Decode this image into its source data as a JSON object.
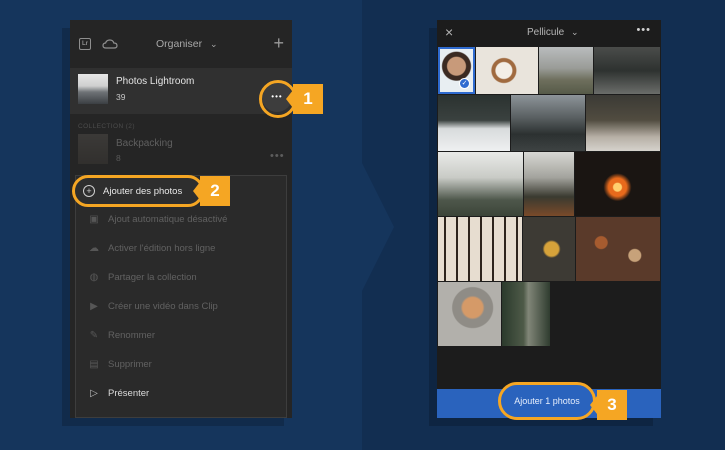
{
  "left_screen": {
    "topbar": {
      "lr_icon_text": "Lr",
      "title": "Organiser",
      "chevron": "⌄",
      "plus": "+"
    },
    "album": {
      "name": "Photos Lightroom",
      "count": "39",
      "more_glyph": "•••"
    },
    "collections": {
      "header": "COLLECTION (2)",
      "items": [
        {
          "name": "Backpacking",
          "count": "8",
          "more_glyph": "•••"
        }
      ]
    },
    "menu": {
      "add_photos": "Ajouter des photos",
      "items": [
        {
          "label": "Ajout automatique désactivé",
          "icon": "auto-add-icon"
        },
        {
          "label": "Activer l'édition hors ligne",
          "icon": "cloud-offline-icon"
        },
        {
          "label": "Partager la collection",
          "icon": "globe-icon"
        },
        {
          "label": "Créer une vidéo dans Clip",
          "icon": "video-icon"
        },
        {
          "label": "Renommer",
          "icon": "pencil-icon"
        },
        {
          "label": "Supprimer",
          "icon": "trash-icon"
        },
        {
          "label": "Présenter",
          "icon": "play-icon"
        }
      ]
    }
  },
  "right_screen": {
    "topbar": {
      "close": "×",
      "title": "Pellicule",
      "chevron": "⌄",
      "more": "•••"
    },
    "add_button_label": "Ajouter 1 photos"
  },
  "steps": {
    "one": "1",
    "two": "2",
    "three": "3"
  },
  "colors": {
    "accent": "#f5a623",
    "brand_blue": "#2a63bd",
    "background": "#15355c"
  }
}
